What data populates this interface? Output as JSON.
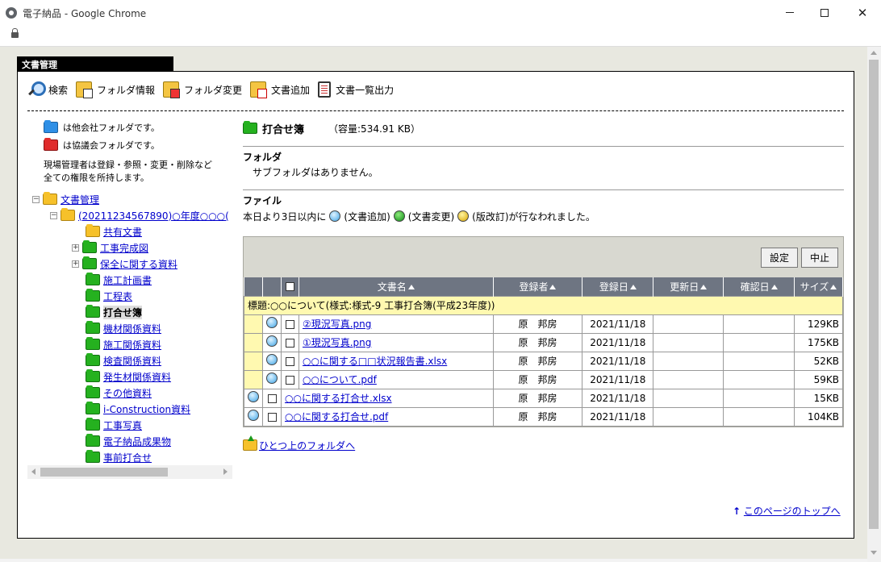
{
  "window": {
    "title": "電子納品 - Google Chrome"
  },
  "tab": {
    "label": "文書管理"
  },
  "toolbar": {
    "items": [
      {
        "label": "検索",
        "icon": "search-icon"
      },
      {
        "label": "フォルダ情報",
        "icon": "folder-info-icon"
      },
      {
        "label": "フォルダ変更",
        "icon": "folder-change-icon"
      },
      {
        "label": "文書追加",
        "icon": "document-add-icon"
      },
      {
        "label": "文書一覧出力",
        "icon": "document-list-output-icon"
      }
    ]
  },
  "legend": {
    "other_company": "は他会社フォルダです。",
    "council": "は協議会フォルダです。",
    "permission_line1": "現場管理者は登録・参照・変更・削除など",
    "permission_line2": "全ての権限を所持します。"
  },
  "tree": {
    "root": "文書管理",
    "project": "(20211234567890)○年度○○○(",
    "items": [
      {
        "label": "共有文書",
        "color": "yellow"
      },
      {
        "label": "工事完成図",
        "color": "green"
      },
      {
        "label": "保全に関する資料",
        "color": "green"
      },
      {
        "label": "施工計画書",
        "color": "green"
      },
      {
        "label": "工程表",
        "color": "green"
      },
      {
        "label": "打合せ簿",
        "color": "green"
      },
      {
        "label": "機材関係資料",
        "color": "green"
      },
      {
        "label": "施工関係資料",
        "color": "green"
      },
      {
        "label": "検査関係資料",
        "color": "green"
      },
      {
        "label": "発生材関係資料",
        "color": "green"
      },
      {
        "label": "その他資料",
        "color": "green"
      },
      {
        "label": "i-Construction資料",
        "color": "green"
      },
      {
        "label": "工事写真",
        "color": "green"
      },
      {
        "label": "電子納品成果物",
        "color": "green"
      },
      {
        "label": "事前打合せ",
        "color": "green"
      }
    ]
  },
  "folder": {
    "name": "打合せ簿",
    "capacity": "（容量:534.91 KB）",
    "section_folder": "フォルダ",
    "no_subfolder": "サブフォルダはありません。",
    "section_file": "ファイル",
    "notice_prefix": "本日より3日以内に",
    "notice_add": "(文書追加)",
    "notice_change": "(文書変更)",
    "notice_revise": "(版改訂)が行なわれました。"
  },
  "buttons": {
    "settings": "設定",
    "cancel": "中止"
  },
  "table": {
    "columns": [
      "文書名",
      "登録者",
      "登録日",
      "更新日",
      "確認日",
      "サイズ"
    ],
    "group_title": "標題:○○について(様式:様式-9 工事打合簿(平成23年度))",
    "grouped_rows": [
      {
        "name": "②現況写真.png",
        "registrant": "原　邦房",
        "registered": "2021/11/18",
        "updated": "",
        "confirmed": "",
        "size": "129KB"
      },
      {
        "name": "①現況写真.png",
        "registrant": "原　邦房",
        "registered": "2021/11/18",
        "updated": "",
        "confirmed": "",
        "size": "175KB"
      },
      {
        "name": "○○に関する□□状況報告書.xlsx",
        "registrant": "原　邦房",
        "registered": "2021/11/18",
        "updated": "",
        "confirmed": "",
        "size": "52KB"
      },
      {
        "name": "○○について.pdf",
        "registrant": "原　邦房",
        "registered": "2021/11/18",
        "updated": "",
        "confirmed": "",
        "size": "59KB"
      }
    ],
    "rows": [
      {
        "name": "○○に関する打合せ.xlsx",
        "registrant": "原　邦房",
        "registered": "2021/11/18",
        "updated": "",
        "confirmed": "",
        "size": "15KB"
      },
      {
        "name": "○○に関する打合せ.pdf",
        "registrant": "原　邦房",
        "registered": "2021/11/18",
        "updated": "",
        "confirmed": "",
        "size": "104KB"
      }
    ]
  },
  "links": {
    "up_folder": "ひとつ上のフォルダへ",
    "page_top": "このページのトップへ"
  },
  "colors": {
    "header_bg": "#6e7582",
    "group_bg": "#fff9b0",
    "link": "#0000cc"
  }
}
